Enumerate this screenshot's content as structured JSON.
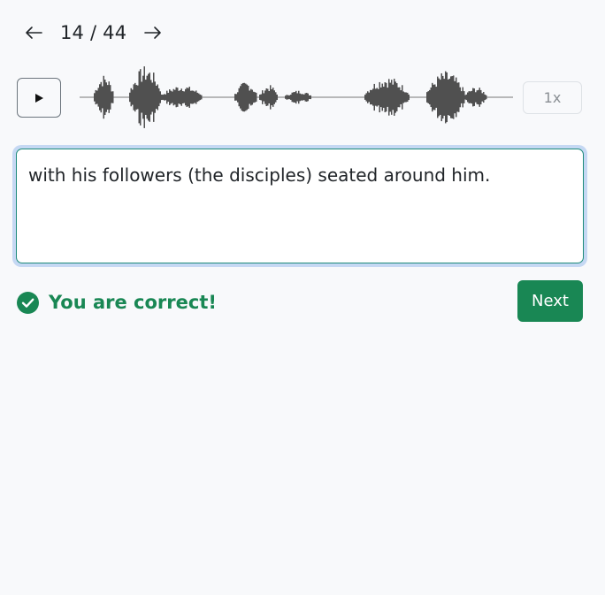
{
  "pager": {
    "prev_icon": "arrow-left-icon",
    "count": "14 / 44",
    "next_icon": "arrow-right-icon"
  },
  "player": {
    "play_icon": "play-icon",
    "waveform_icon": "audio-waveform",
    "speed": "1x"
  },
  "answer": {
    "text": "with his followers (the disciples) seated around him."
  },
  "result": {
    "icon": "check-circle-icon",
    "message": "You are correct!",
    "color": "#198754"
  },
  "actions": {
    "next_label": "Next",
    "next_color": "#198754"
  }
}
